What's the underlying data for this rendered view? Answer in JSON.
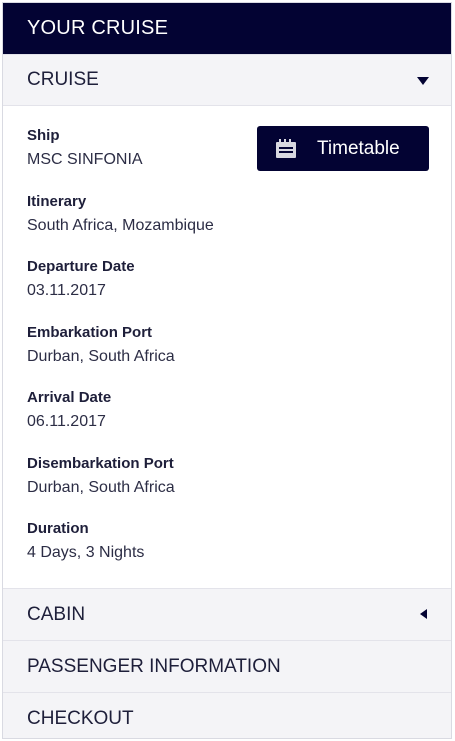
{
  "panel": {
    "title": "YOUR CRUISE"
  },
  "cruise_section": {
    "title": "CRUISE",
    "timetable_label": "Timetable",
    "fields": [
      {
        "label": "Ship",
        "value": "MSC SINFONIA"
      },
      {
        "label": "Itinerary",
        "value": "South Africa, Mozambique"
      },
      {
        "label": "Departure Date",
        "value": "03.11.2017"
      },
      {
        "label": "Embarkation Port",
        "value": "Durban, South Africa"
      },
      {
        "label": "Arrival Date",
        "value": "06.11.2017"
      },
      {
        "label": "Disembarkation Port",
        "value": "Durban, South Africa"
      },
      {
        "label": "Duration",
        "value": "4 Days, 3 Nights"
      }
    ]
  },
  "cabin_section": {
    "title": "CABIN"
  },
  "passenger_section": {
    "title": "PASSENGER INFORMATION"
  },
  "checkout_section": {
    "title": "CHECKOUT"
  },
  "colors": {
    "primary": "#030333",
    "section_bg": "#f4f4f7",
    "text": "#1e1f3a"
  },
  "icons": {
    "timetable": "calendar-icon",
    "expanded": "chevron-down-icon",
    "collapsed": "chevron-left-icon"
  }
}
